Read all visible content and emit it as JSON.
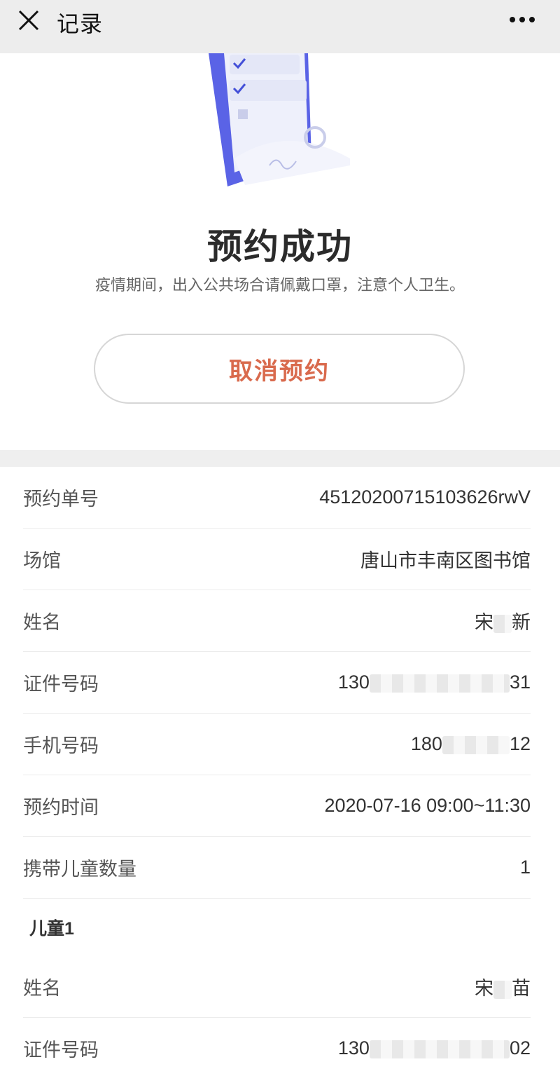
{
  "header": {
    "title": "记录",
    "close_icon": "close-icon",
    "more_icon": "more-icon"
  },
  "hero": {
    "illustration": "document-check-illustration",
    "title": "预约成功",
    "notice": "疫情期间，出入公共场合请佩戴口罩，注意个人卫生。",
    "cancel_label": "取消预约"
  },
  "details": {
    "order_no": {
      "label": "预约单号",
      "value": "4512020071510 3626rwV"
    },
    "venue": {
      "label": "场馆",
      "value": "唐山市丰南区图书馆"
    },
    "name": {
      "label": "姓名",
      "prefix": "宋",
      "suffix": "新"
    },
    "id_no": {
      "label": "证件号码",
      "prefix": "130",
      "suffix": "31"
    },
    "phone": {
      "label": "手机号码",
      "prefix": "180",
      "suffix": "12"
    },
    "time": {
      "label": "预约时间",
      "value": "2020-07-16 09:00~11:30"
    },
    "children_count": {
      "label": "携带儿童数量",
      "value": "1"
    }
  },
  "child": {
    "section_title": "儿童1",
    "name": {
      "label": "姓名",
      "prefix": "宋",
      "suffix": "苗"
    },
    "id_no": {
      "label": "证件号码",
      "prefix": "130",
      "suffix": "02"
    }
  },
  "colors": {
    "accent": "#d96a4d",
    "topbar": "#ededed",
    "band": "#efefef"
  }
}
